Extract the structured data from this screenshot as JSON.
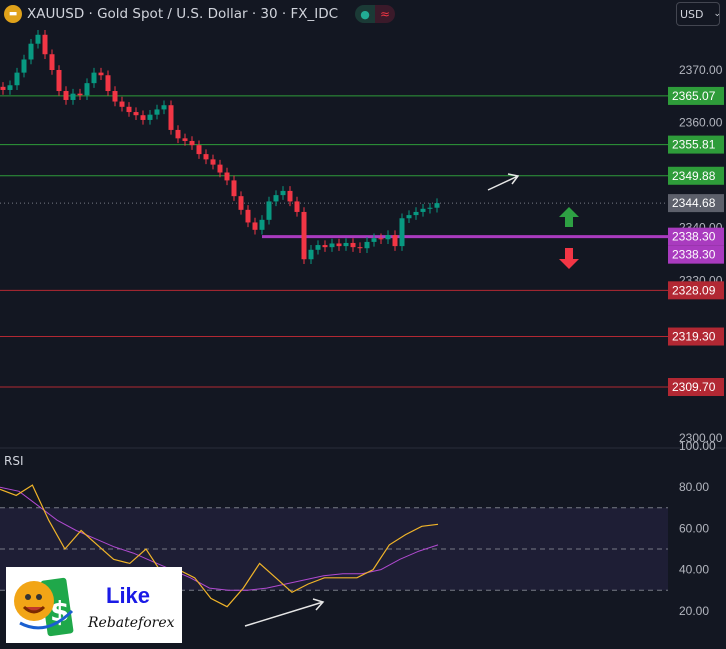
{
  "header": {
    "symbol": "XAUUSD · Gold Spot / U.S. Dollar · 30 · FX_IDC",
    "status_dot": "market-open-dot",
    "status_icon": "≈"
  },
  "currency": {
    "selected": "USD"
  },
  "rsi": {
    "title": "RSI"
  },
  "brand": {
    "line1": "Like",
    "line2": "Rebateforex"
  },
  "colors": {
    "up": "#089981",
    "down": "#f23645",
    "resistance": "#2e9c3a",
    "support": "#b22833",
    "pivot": "#a93bbf",
    "rsi": "#f0b429",
    "rsi_ma": "#b04ad0"
  },
  "chart_data": [
    {
      "type": "candlestick",
      "title": "XAUUSD · Gold Spot / U.S. Dollar · 30 · FX_IDC",
      "yticks": [
        "2370.00",
        "2360.00",
        "2350.00",
        "2340.00",
        "2330.00",
        "2300.00"
      ],
      "ytick_values": [
        2370,
        2360,
        2350,
        2340,
        2330,
        2300
      ],
      "ylim": [
        2300,
        2370
      ],
      "closes": [
        2366.2,
        2367.1,
        2369.5,
        2372,
        2375,
        2376.7,
        2373,
        2370,
        2366,
        2364.3,
        2365.5,
        2365.2,
        2367.5,
        2369.5,
        2369,
        2366,
        2364,
        2363,
        2362,
        2361.4,
        2360.5,
        2361.5,
        2362.5,
        2363.3,
        2358.6,
        2357,
        2356.5,
        2355.7,
        2354,
        2353,
        2352,
        2350.5,
        2349,
        2346,
        2343.4,
        2341,
        2339.6,
        2341.5,
        2345,
        2346.2,
        2347,
        2345,
        2343,
        2334,
        2335.8,
        2336.7,
        2336.3,
        2337,
        2336.5,
        2337.1,
        2336.3,
        2336.1,
        2337.3,
        2338,
        2337.8,
        2338.6,
        2336.5,
        2341.8,
        2342.4,
        2343,
        2343.6,
        2343.8,
        2344.68
      ],
      "levels": [
        {
          "value": 2365.07,
          "label": "2365.07",
          "kind": "resistance"
        },
        {
          "value": 2355.81,
          "label": "2355.81",
          "kind": "resistance"
        },
        {
          "value": 2349.88,
          "label": "2349.88",
          "kind": "resistance"
        },
        {
          "value": 2344.68,
          "label": "2344.68",
          "kind": "last"
        },
        {
          "value": 2338.3,
          "label": "2338.30",
          "kind": "pivot"
        },
        {
          "value": 2328.09,
          "label": "2328.09",
          "kind": "support"
        },
        {
          "value": 2319.3,
          "label": "2319.30",
          "kind": "support"
        },
        {
          "value": 2309.7,
          "label": "2309.70",
          "kind": "support"
        }
      ],
      "pivot_duplicate_label": "2338.30",
      "annotations": [
        "up-arrow-bullish",
        "down-arrow-bearish",
        "trend-arrow"
      ]
    },
    {
      "type": "line",
      "title": "RSI",
      "yticks": [
        "100.00",
        "80.00",
        "60.00",
        "40.00",
        "20.00"
      ],
      "ytick_values": [
        100,
        80,
        60,
        40,
        20
      ],
      "ylim": [
        0,
        100
      ],
      "band": [
        30,
        70
      ],
      "midline": 50,
      "series": [
        {
          "key": "rsi",
          "values": [
            79,
            76,
            81,
            64,
            50,
            59,
            52,
            45,
            43,
            50,
            38,
            40,
            36,
            26,
            22,
            31,
            43,
            36,
            29,
            33,
            36,
            36,
            36,
            40,
            52,
            57,
            61,
            62
          ]
        },
        {
          "key": "rsi_ma",
          "values": [
            80,
            78,
            71,
            64,
            59,
            55,
            51,
            48,
            44,
            40,
            36,
            31,
            30,
            30,
            31,
            33,
            35,
            37,
            38,
            38,
            40,
            45,
            49,
            52
          ]
        }
      ],
      "annotations": [
        "divergence-arrow"
      ]
    }
  ]
}
